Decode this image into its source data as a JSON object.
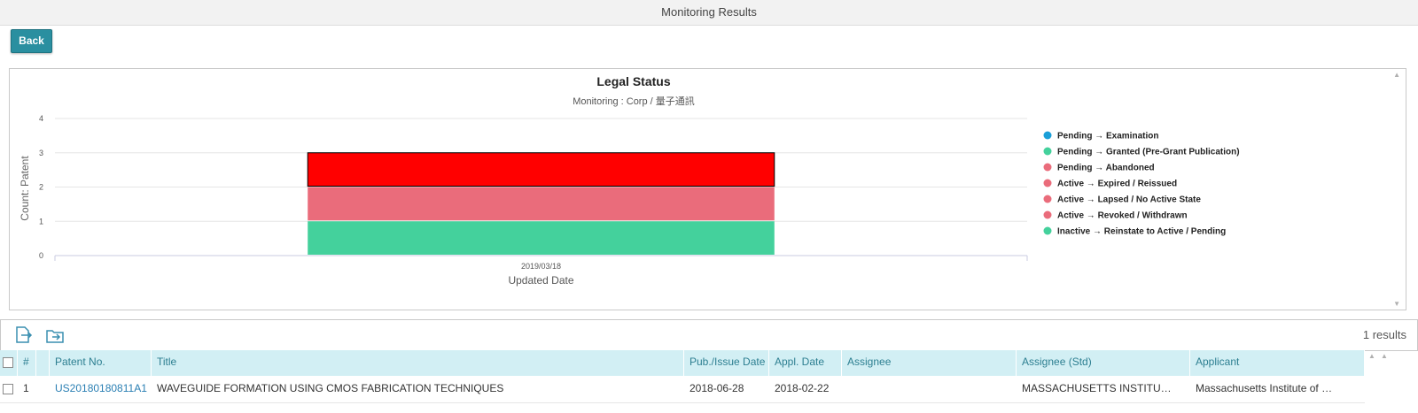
{
  "window": {
    "title": "Monitoring Results"
  },
  "toolbar": {
    "back_label": "Back"
  },
  "chart_data": {
    "type": "bar",
    "title": "Legal Status",
    "subtitle": "Monitoring : Corp / 量子通訊",
    "xlabel": "Updated Date",
    "ylabel": "Count: Patent",
    "ylim": [
      0,
      4
    ],
    "yticks": [
      "0",
      "1",
      "2",
      "3",
      "4"
    ],
    "categories": [
      "2019/03/18"
    ],
    "stacked": true,
    "legend_position": "right",
    "grid": true,
    "series": [
      {
        "name": "Pending → Examination",
        "color": "#1a9fd8",
        "values": [
          0
        ]
      },
      {
        "name": "Pending → Granted (Pre-Grant Publication)",
        "color": "#44d19c",
        "values": [
          1
        ]
      },
      {
        "name": "Pending → Abandoned",
        "color": "#ea6c7b",
        "values": [
          1
        ]
      },
      {
        "name": "Active → Expired / Reissued",
        "color": "#ea6c7b",
        "values": [
          0
        ]
      },
      {
        "name": "Active → Lapsed / No Active State",
        "color": "#ea6c7b",
        "values": [
          0
        ]
      },
      {
        "name": "Active → Revoked / Withdrawn",
        "color": "#ea6c7b",
        "values": [
          0
        ]
      },
      {
        "name": "Inactive → Reinstate to Active / Pending",
        "color": "#44d19c",
        "values": [
          0
        ]
      }
    ],
    "highlight_segment": {
      "color": "#ff0000",
      "from": 2,
      "to": 3
    }
  },
  "results": {
    "count_label": "1 results"
  },
  "table": {
    "columns": [
      "#",
      "Patent No.",
      "Title",
      "Pub./Issue Date",
      "Appl. Date",
      "Assignee",
      "Assignee (Std)",
      "Applicant"
    ],
    "rows": [
      {
        "index": "1",
        "patent_no": "US20180180811A1",
        "title": "WAVEGUIDE FORMATION USING CMOS FABRICATION TECHNIQUES",
        "pub_date": "2018-06-28",
        "appl_date": "2018-02-22",
        "assignee": "",
        "assignee_std": "MASSACHUSETTS INSTITU…",
        "applicant": "Massachusetts Institute of …"
      }
    ]
  },
  "icons": {
    "export": "export-file-icon",
    "folder": "folder-export-icon"
  }
}
